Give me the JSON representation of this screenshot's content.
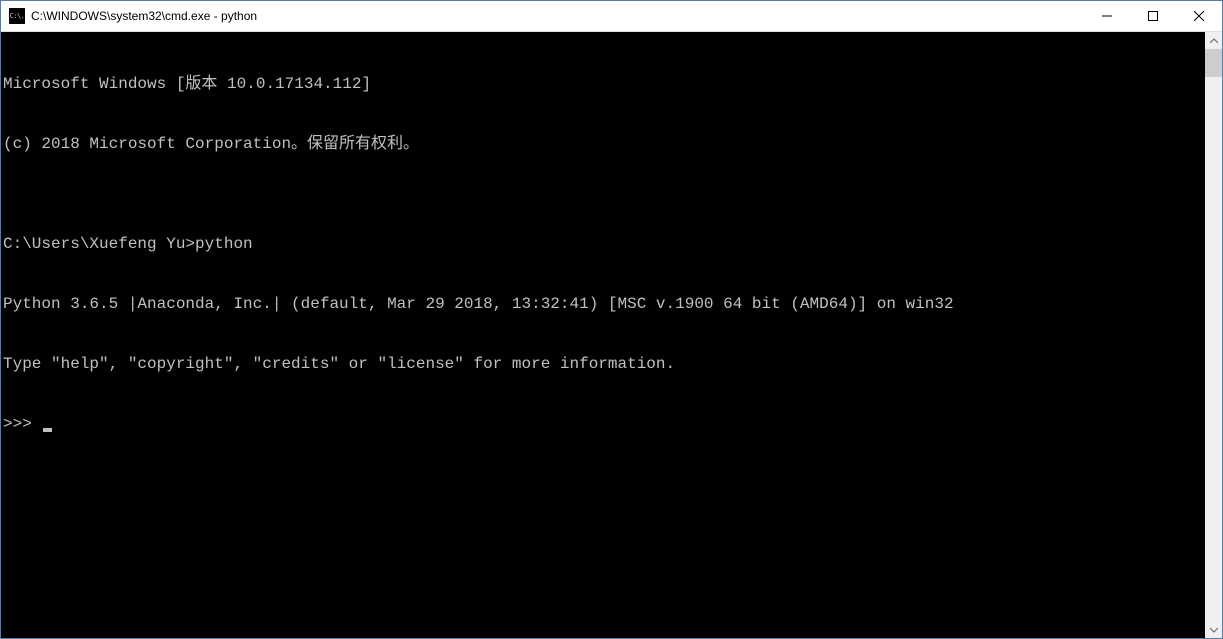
{
  "window": {
    "title": "C:\\WINDOWS\\system32\\cmd.exe - python",
    "icon_text": "C:\\."
  },
  "terminal": {
    "line1": "Microsoft Windows [版本 10.0.17134.112]",
    "line2": "(c) 2018 Microsoft Corporation。保留所有权利。",
    "line3": "",
    "line4": "C:\\Users\\Xuefeng Yu>python",
    "line5": "Python 3.6.5 |Anaconda, Inc.| (default, Mar 29 2018, 13:32:41) [MSC v.1900 64 bit (AMD64)] on win32",
    "line6": "Type \"help\", \"copyright\", \"credits\" or \"license\" for more information.",
    "prompt": ">>> "
  }
}
